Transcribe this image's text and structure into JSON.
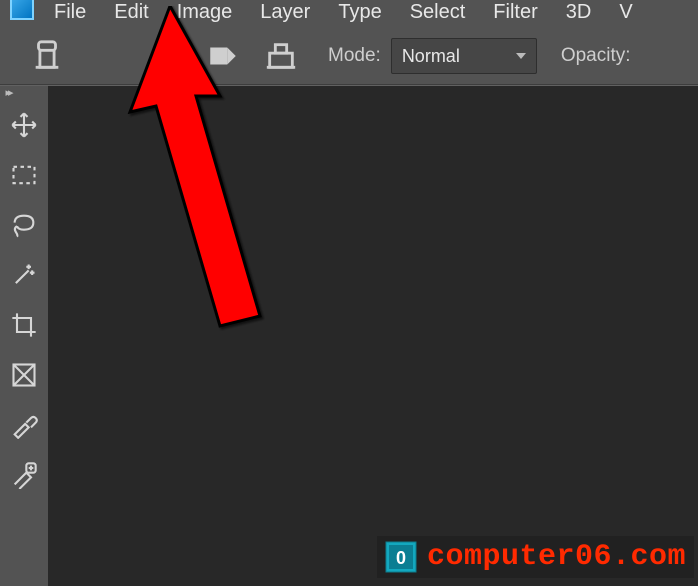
{
  "menubar": {
    "items": [
      "File",
      "Edit",
      "Image",
      "Layer",
      "Type",
      "Select",
      "Filter",
      "3D",
      "V"
    ]
  },
  "optionsbar": {
    "mode_label": "Mode:",
    "mode_value": "Normal",
    "opacity_label": "Opacity:"
  },
  "toolbar": {
    "tools": [
      "move-tool",
      "rect-marquee-tool",
      "lasso-tool",
      "magic-wand-tool",
      "crop-tool",
      "frame-tool",
      "eyedropper-tool",
      "spot-healing-tool"
    ]
  },
  "watermark": {
    "text": "computer06.com"
  },
  "annotation": {
    "arrow_points_to_menu_index": 1
  }
}
